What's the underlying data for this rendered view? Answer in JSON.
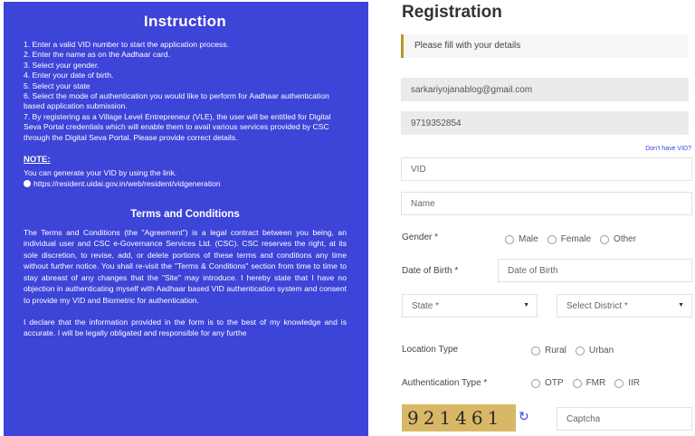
{
  "instruction": {
    "title": "Instruction",
    "items": [
      "1. Enter a valid VID number to start the application process.",
      "2. Enter the name as on the Aadhaar card.",
      "3. Select your gender.",
      "4. Enter your date of birth.",
      "5. Select your state",
      "6. Select the mode of authentication you would like to perform for Aadhaar authentication based application submission.",
      "7. By registering as a Village Level Entrepreneur (VLE), the user will be entitled for Digital Seva Portal credentials which will enable them to avail various services provided by CSC through the Digital Seva Portal. Please provide correct details."
    ],
    "note_title": "NOTE:",
    "note_text": "You can generate your VID by using the link.",
    "note_link": "https://resident.uidai.gov.in/web/resident/vidgeneration",
    "terms_title": "Terms and Conditions",
    "terms_text": "The Terms and Conditions (the \"Agreement\") is a legal contract between you being, an individual user and CSC e-Governance Services Ltd. (CSC). CSC reserves the right, at its sole discretion, to revise, add, or delete portions of these terms and conditions any time without further notice. You shall re-visit the \"Terms & Conditions\" section from time to time to stay abreast of any changes that the \"Site\" may introduce. I hereby state that I have no objection in authenticating myself with Aadhaar based VID authentication system and consent to provide my VID and Biometric for authentication.",
    "declare_text": "I declare that the information provided in the form is to the best of my knowledge and is accurate. I will be legally obligated and responsible for any furthe"
  },
  "form": {
    "title": "Registration",
    "notice": "Please fill with your details",
    "email_value": "sarkariyojanablog@gmail.com",
    "phone_value": "9719352854",
    "dont_have_vid": "Don't have VID?",
    "vid_placeholder": "VID",
    "name_placeholder": "Name",
    "gender_label": "Gender *",
    "gender_options": [
      "Male",
      "Female",
      "Other"
    ],
    "dob_label": "Date of Birth *",
    "dob_placeholder": "Date of Birth",
    "state_select": "State *",
    "district_select": "Select District *",
    "location_label": "Location Type",
    "location_options": [
      "Rural",
      "Urban"
    ],
    "auth_label": "Authentication Type *",
    "auth_options": [
      "OTP",
      "FMR",
      "IIR"
    ],
    "captcha_text": "921461",
    "captcha_placeholder": "Captcha"
  },
  "colors": {
    "panel_blue": "#3d44d8",
    "notice_border": "#b8962e",
    "captcha_bg": "#d8b866"
  }
}
